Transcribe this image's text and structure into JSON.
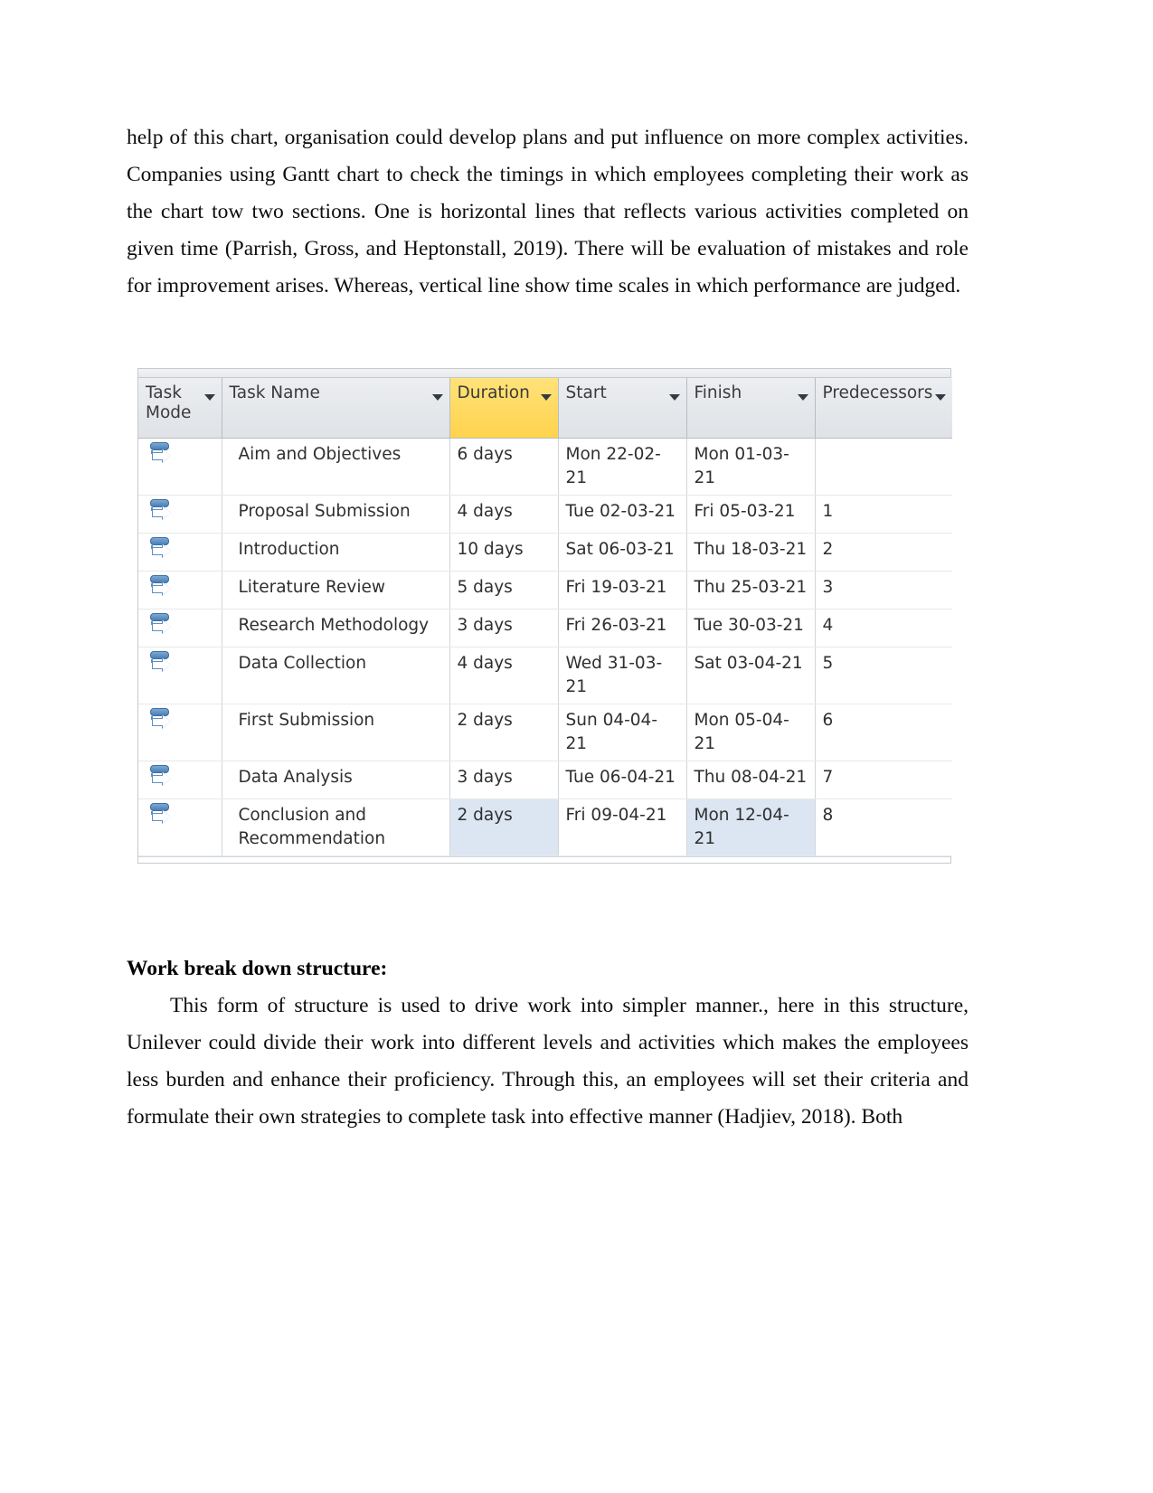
{
  "document": {
    "paragraph_1": "help of this chart, organisation could develop plans and put influence on more complex activities. Companies using Gantt chart to check the timings in which employees completing their work as the chart tow two sections. One is horizontal lines  that reflects various activities completed on given time (Parrish, Gross, and Heptonstall, 2019). There will be evaluation of mistakes and role for improvement arises. Whereas, vertical line show time scales in which performance are judged.",
    "heading_wbs": "Work break down structure:",
    "paragraph_2": "This form of structure is used to drive work into simpler manner., here in this structure, Unilever could divide their work into different levels and activities which makes  the employees less burden and enhance their proficiency. Through this, an employees will set their criteria and formulate their own strategies to complete task into effective manner (Hadjiev, 2018). Both"
  },
  "project_table": {
    "columns": [
      {
        "key": "task_mode",
        "label": "Task Mode",
        "has_filter": true,
        "highlighted": false
      },
      {
        "key": "task_name",
        "label": "Task Name",
        "has_filter": true,
        "highlighted": false
      },
      {
        "key": "duration",
        "label": "Duration",
        "has_filter": true,
        "highlighted": true
      },
      {
        "key": "start",
        "label": "Start",
        "has_filter": true,
        "highlighted": false
      },
      {
        "key": "finish",
        "label": "Finish",
        "has_filter": true,
        "highlighted": false
      },
      {
        "key": "predecessors",
        "label": "Predecessors",
        "has_filter": true,
        "highlighted": false
      }
    ],
    "highlight_color": "#ffd34d",
    "selection_color": "#dbe6f2",
    "task_mode_icon": "auto-schedule-icon",
    "rows": [
      {
        "task_mode": "auto-schedule-icon",
        "task_name": "Aim and Objectives",
        "duration": "6 days",
        "start": "Mon 22-02-21",
        "finish": "Mon 01-03-21",
        "predecessors": "",
        "selected": false
      },
      {
        "task_mode": "auto-schedule-icon",
        "task_name": "Proposal Submission",
        "duration": "4 days",
        "start": "Tue 02-03-21",
        "finish": "Fri 05-03-21",
        "predecessors": "1",
        "selected": false
      },
      {
        "task_mode": "auto-schedule-icon",
        "task_name": "Introduction",
        "duration": "10 days",
        "start": "Sat 06-03-21",
        "finish": "Thu 18-03-21",
        "predecessors": "2",
        "selected": false
      },
      {
        "task_mode": "auto-schedule-icon",
        "task_name": "Literature Review",
        "duration": "5 days",
        "start": "Fri 19-03-21",
        "finish": "Thu 25-03-21",
        "predecessors": "3",
        "selected": false
      },
      {
        "task_mode": "auto-schedule-icon",
        "task_name": "Research Methodology",
        "duration": "3 days",
        "start": "Fri 26-03-21",
        "finish": "Tue 30-03-21",
        "predecessors": "4",
        "selected": false
      },
      {
        "task_mode": "auto-schedule-icon",
        "task_name": "Data Collection",
        "duration": "4 days",
        "start": "Wed 31-03-21",
        "finish": "Sat 03-04-21",
        "predecessors": "5",
        "selected": false
      },
      {
        "task_mode": "auto-schedule-icon",
        "task_name": "First Submission",
        "duration": "2 days",
        "start": "Sun 04-04-21",
        "finish": "Mon 05-04-21",
        "predecessors": "6",
        "selected": false
      },
      {
        "task_mode": "auto-schedule-icon",
        "task_name": "Data Analysis",
        "duration": "3 days",
        "start": "Tue 06-04-21",
        "finish": "Thu 08-04-21",
        "predecessors": "7",
        "selected": false
      },
      {
        "task_mode": "auto-schedule-icon",
        "task_name": "Conclusion and Recommendation",
        "duration": "2 days",
        "start": "Fri 09-04-21",
        "finish": "Mon 12-04-21",
        "predecessors": "8",
        "selected": true
      }
    ]
  }
}
